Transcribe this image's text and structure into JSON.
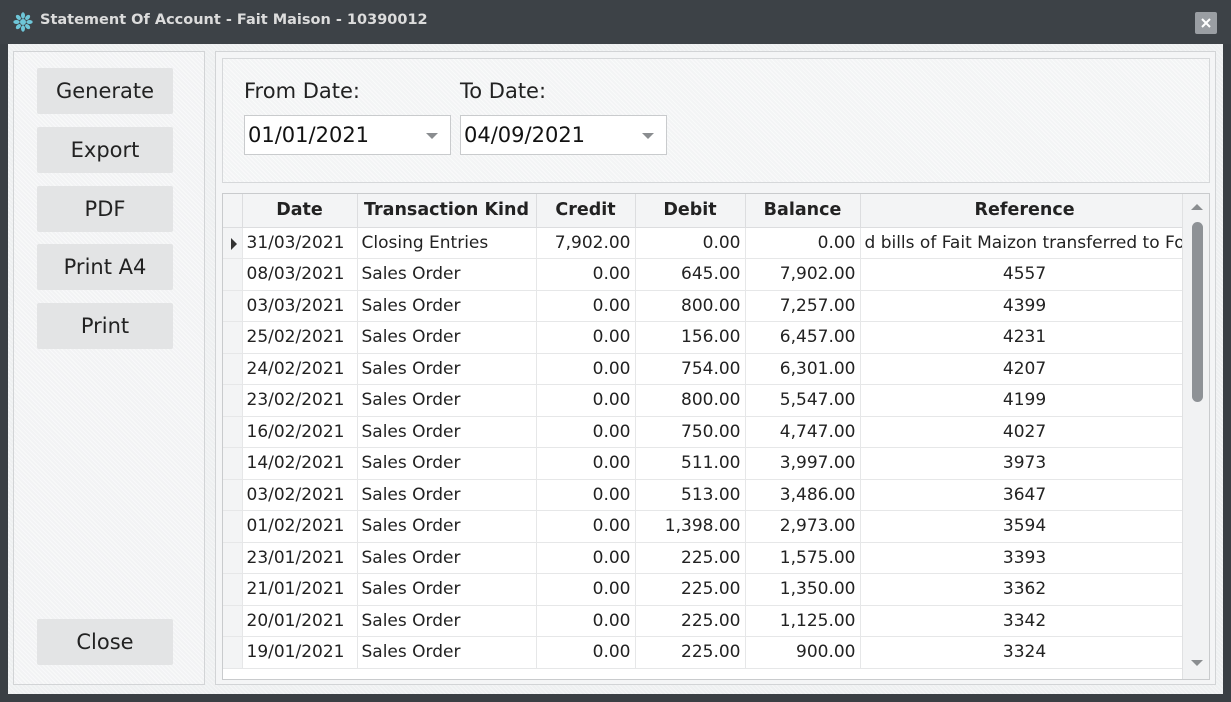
{
  "window": {
    "title": "Statement Of Account - Fait Maison - 10390012"
  },
  "buttons": {
    "generate": "Generate",
    "export": "Export",
    "pdf": "PDF",
    "print_a4": "Print A4",
    "print": "Print",
    "close": "Close"
  },
  "filters": {
    "from_label": "From Date:",
    "from_value": "01/01/2021",
    "to_label": "To Date:",
    "to_value": "04/09/2021"
  },
  "grid": {
    "columns": [
      "Date",
      "Transaction Kind",
      "Credit",
      "Debit",
      "Balance",
      "Reference"
    ],
    "rows": [
      [
        "31/03/2021",
        "Closing Entries",
        "7,902.00",
        "0.00",
        "0.00",
        "d bills of Fait Maizon transferred to Fo"
      ],
      [
        "08/03/2021",
        "Sales Order",
        "0.00",
        "645.00",
        "7,902.00",
        "4557"
      ],
      [
        "03/03/2021",
        "Sales Order",
        "0.00",
        "800.00",
        "7,257.00",
        "4399"
      ],
      [
        "25/02/2021",
        "Sales Order",
        "0.00",
        "156.00",
        "6,457.00",
        "4231"
      ],
      [
        "24/02/2021",
        "Sales Order",
        "0.00",
        "754.00",
        "6,301.00",
        "4207"
      ],
      [
        "23/02/2021",
        "Sales Order",
        "0.00",
        "800.00",
        "5,547.00",
        "4199"
      ],
      [
        "16/02/2021",
        "Sales Order",
        "0.00",
        "750.00",
        "4,747.00",
        "4027"
      ],
      [
        "14/02/2021",
        "Sales Order",
        "0.00",
        "511.00",
        "3,997.00",
        "3973"
      ],
      [
        "03/02/2021",
        "Sales Order",
        "0.00",
        "513.00",
        "3,486.00",
        "3647"
      ],
      [
        "01/02/2021",
        "Sales Order",
        "0.00",
        "1,398.00",
        "2,973.00",
        "3594"
      ],
      [
        "23/01/2021",
        "Sales Order",
        "0.00",
        "225.00",
        "1,575.00",
        "3393"
      ],
      [
        "21/01/2021",
        "Sales Order",
        "0.00",
        "225.00",
        "1,350.00",
        "3362"
      ],
      [
        "20/01/2021",
        "Sales Order",
        "0.00",
        "225.00",
        "1,125.00",
        "3342"
      ],
      [
        "19/01/2021",
        "Sales Order",
        "0.00",
        "225.00",
        "900.00",
        "3324"
      ]
    ]
  },
  "icons": {
    "app": "gear-flower-icon",
    "close": "close-icon",
    "dropdown": "chevron-down-icon",
    "row_indicator": "row-indicator-icon",
    "scroll_up": "scroll-up-icon",
    "scroll_down": "scroll-down-icon"
  },
  "colors": {
    "titlebar": "#3d4247",
    "app_icon": "#6ec6d8"
  }
}
